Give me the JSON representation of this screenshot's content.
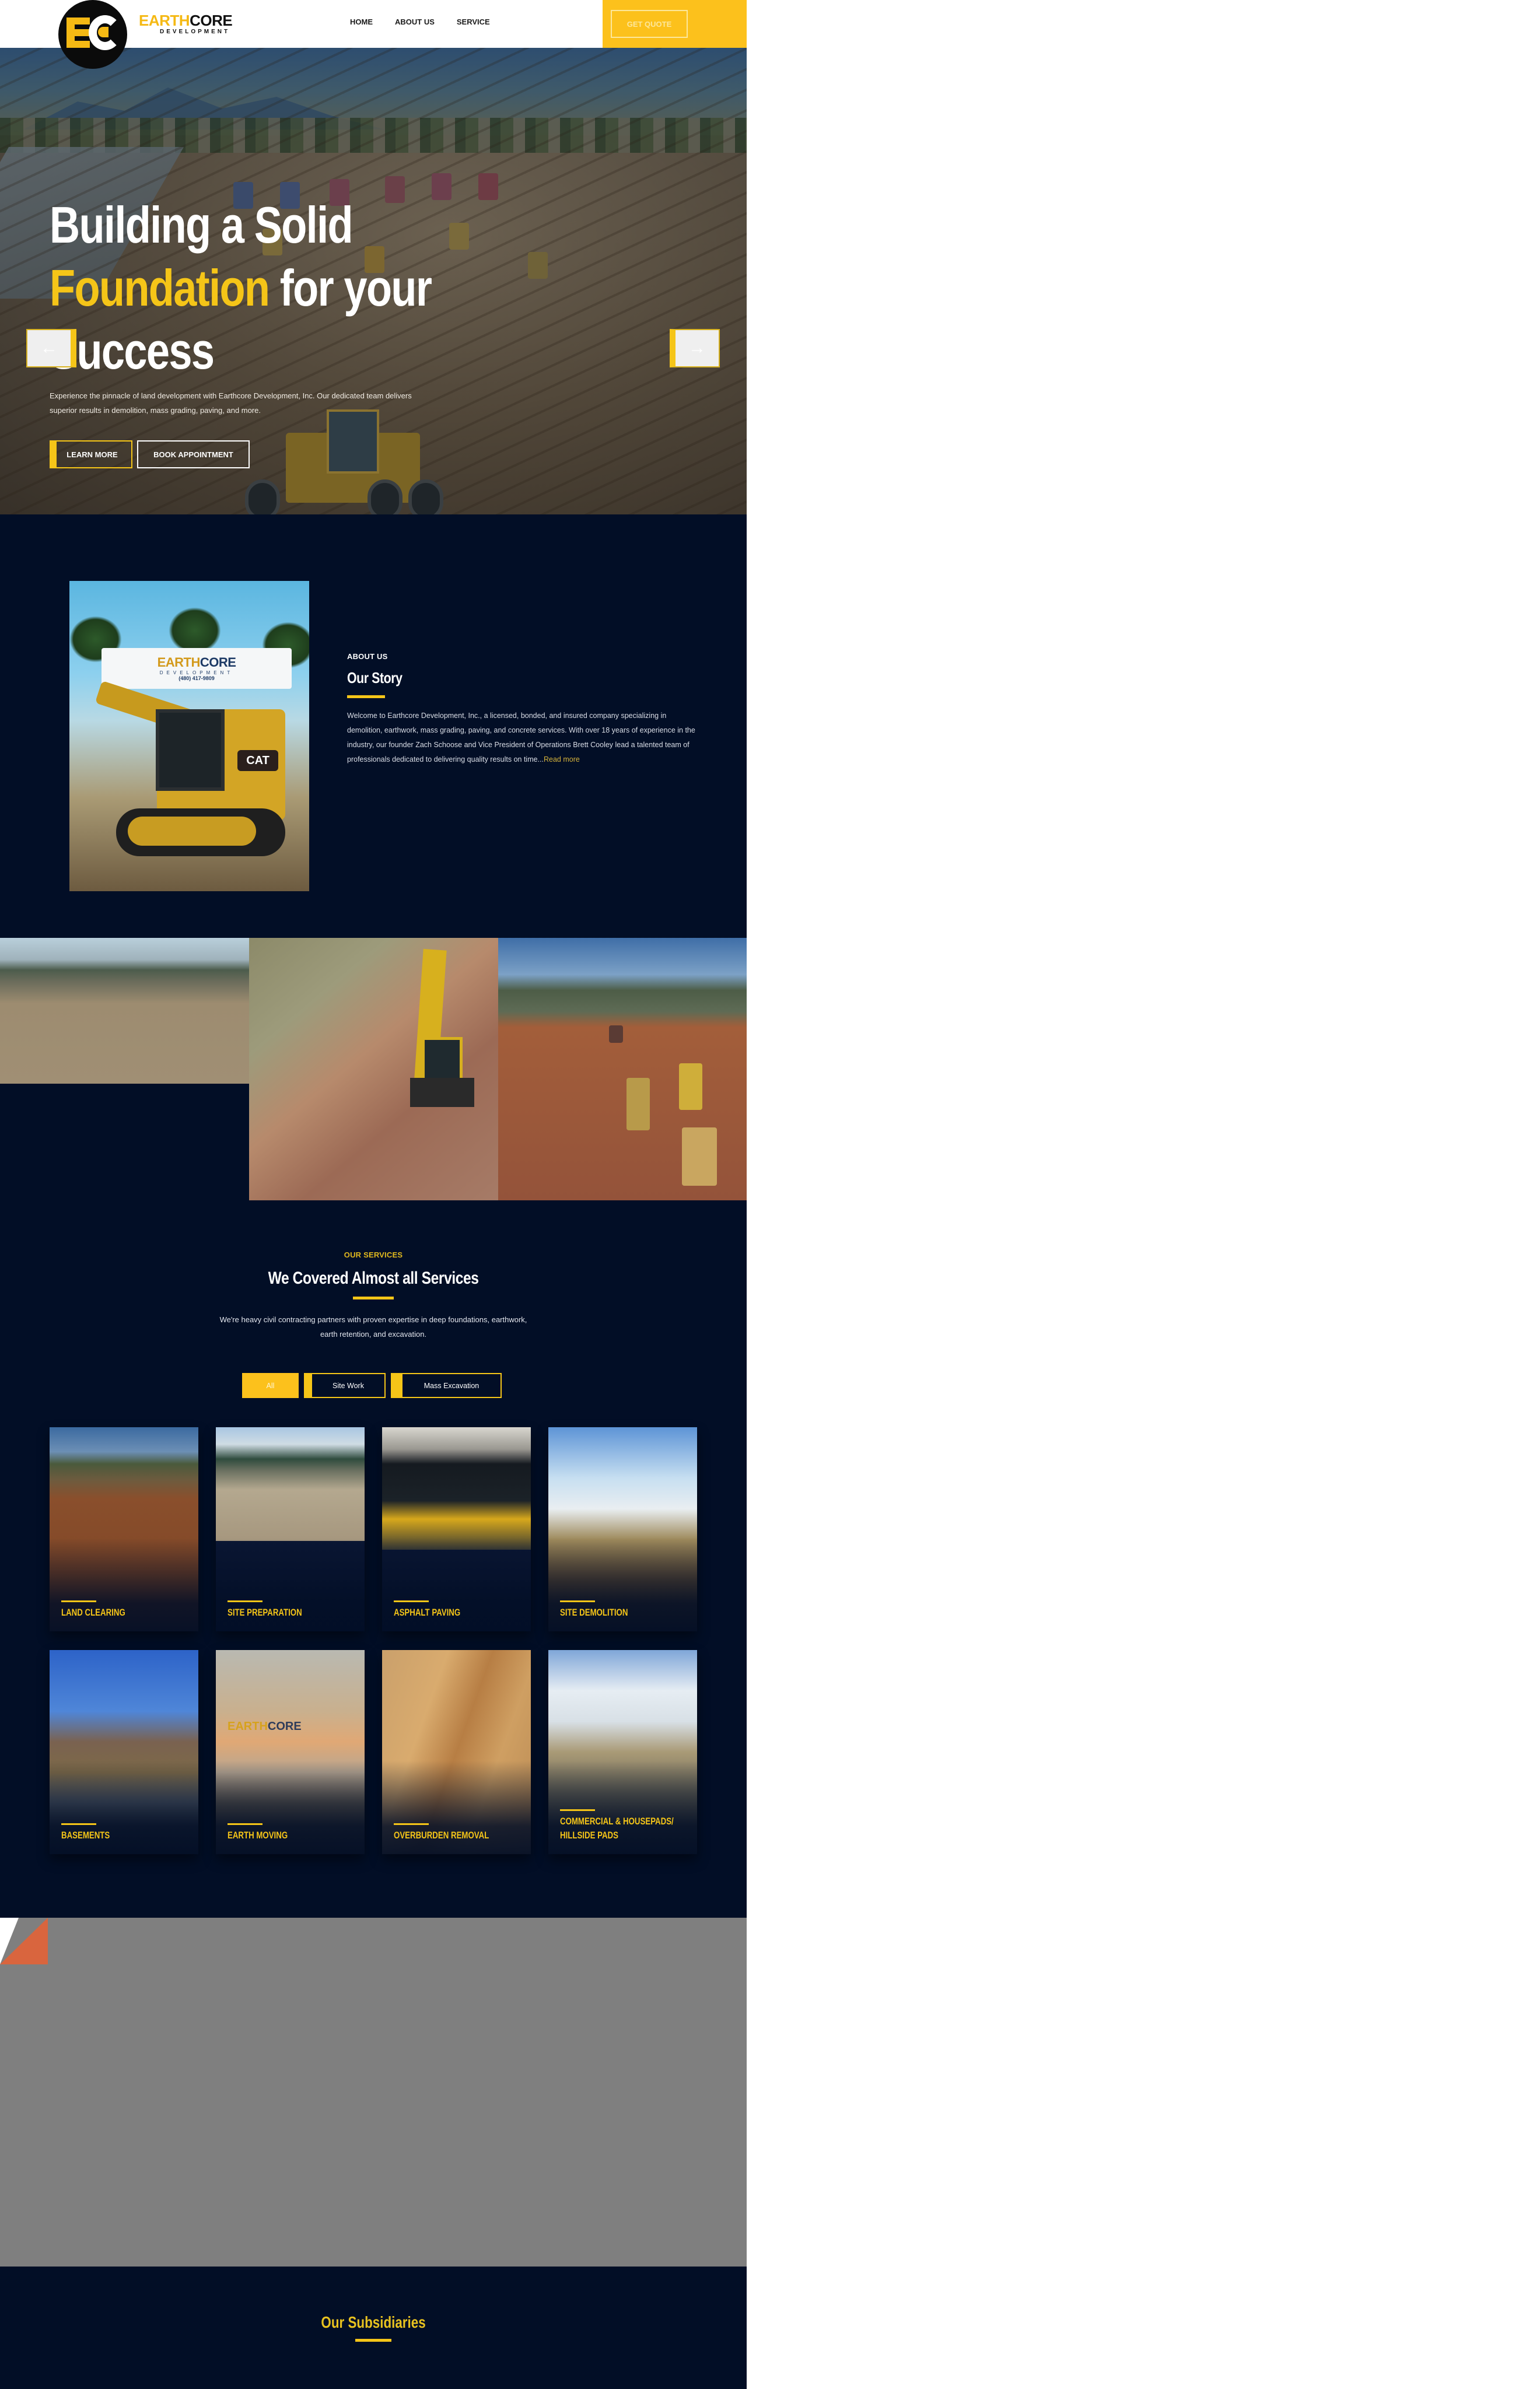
{
  "brand": {
    "badge_letters": "EC",
    "name_part1": "EARTH",
    "name_part2": "CORE",
    "tagline": "DEVELOPMENT"
  },
  "nav": {
    "items": [
      {
        "label": "HOME"
      },
      {
        "label": "ABOUT US"
      },
      {
        "label": "SERVICE"
      }
    ],
    "cta_label": "GET QUOTE"
  },
  "hero": {
    "title_line1": "Building a Solid",
    "title_accent": "Foundation",
    "title_line2_rest": " for your",
    "title_line3": "Success",
    "description": "Experience the pinnacle of land development with Earthcore Development, Inc. Our dedicated team delivers superior results in demolition, mass grading, paving, and more.",
    "primary_button": "LEARN MORE",
    "secondary_button": "BOOK APPOINTMENT",
    "prev_icon": "←",
    "next_icon": "→"
  },
  "about": {
    "eyebrow": "ABOUT US",
    "title": "Our Story",
    "body": "Welcome to Earthcore Development, Inc., a licensed, bonded, and insured company specializing in demolition, earthwork, mass grading, paving, and concrete services. With over 18 years of experience in the industry, our founder Zach Schoose and Vice President of Operations Brett Cooley lead a talented team of professionals dedicated to delivering quality results on time...",
    "read_more": "Read more",
    "image_sign": {
      "part1": "EARTH",
      "part2": "CORE",
      "line2": "DEVELOPMENT",
      "phone": "(480) 417-9809"
    },
    "image_badge": "CAT"
  },
  "services": {
    "eyebrow": "OUR SERVICES",
    "title": "We Covered Almost all Services",
    "description": "We're heavy civil contracting partners with proven expertise in deep foundations, earthwork, earth retention, and excavation.",
    "filters": [
      {
        "label": "All",
        "active": true
      },
      {
        "label": "Site Work",
        "active": false
      },
      {
        "label": "Mass Excavation",
        "active": false
      }
    ],
    "cards": [
      {
        "title": "LAND CLEARING"
      },
      {
        "title": "SITE PREPARATION"
      },
      {
        "title": "ASPHALT PAVING"
      },
      {
        "title": "SITE DEMOLITION"
      },
      {
        "title": "BASEMENTS"
      },
      {
        "title": "EARTH MOVING"
      },
      {
        "title": "OVERBURDEN REMOVAL"
      },
      {
        "title": "COMMERCIAL & HOUSEPADS/ HILLSIDE PADS"
      }
    ],
    "earth_moving_sign": {
      "part1": "EARTH",
      "part2": "CORE"
    }
  },
  "subsidiaries": {
    "title": "Our Subsidiaries"
  },
  "colors": {
    "accent": "#f5c518",
    "navy": "#020e26",
    "grey_block": "#7f7f7f",
    "corner_orange": "#d9653e"
  }
}
